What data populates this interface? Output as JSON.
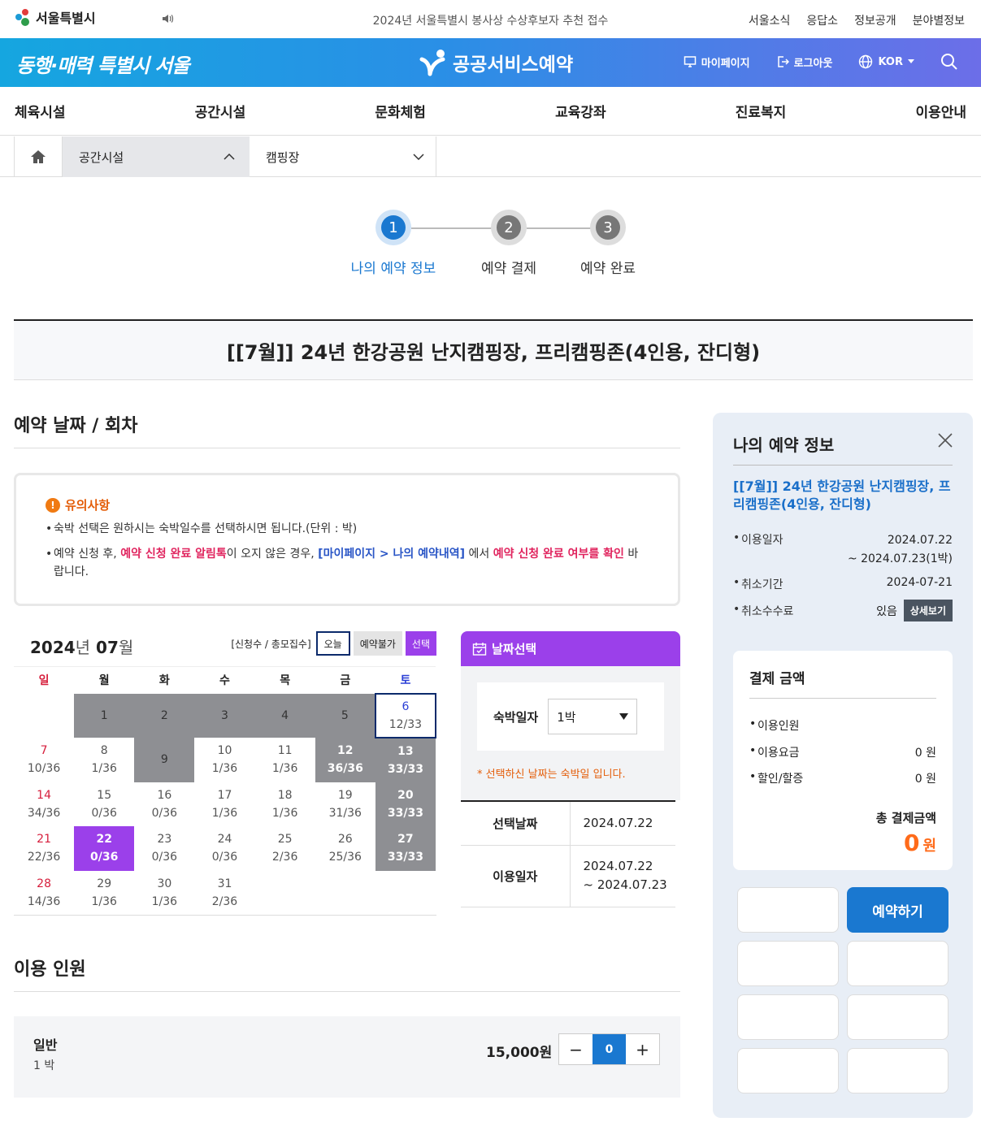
{
  "topbar": {
    "logo": "서울특별시",
    "notice": "2024년 서울특별시 봉사상 수상후보자 추천 접수",
    "links": [
      "서울소식",
      "응답소",
      "정보공개",
      "분야별정보"
    ]
  },
  "banner": {
    "slogan": "동행·매력 특별시 서울",
    "service": "공공서비스예약",
    "mypage": "마이페이지",
    "logout": "로그아웃",
    "lang": "KOR"
  },
  "gnb": [
    "체육시설",
    "공간시설",
    "문화체험",
    "교육강좌",
    "진료복지",
    "이용안내"
  ],
  "breadcrumb": {
    "level1": "공간시설",
    "level2": "캠핑장"
  },
  "steps": [
    "나의 예약 정보",
    "예약 결제",
    "예약 완료"
  ],
  "step_numbers": [
    "1",
    "2",
    "3"
  ],
  "title": "[[7월]] 24년 한강공원 난지캠핑장, 프리캠핑존(4인용, 잔디형)",
  "section_date": "예약 날짜 / 회차",
  "caution": {
    "head": "유의사항",
    "item1": "숙박 선택은 원하시는 숙박일수를 선택하시면 됩니다.(단위 : 박)",
    "item2_a": "예약 신청 후, ",
    "item2_b": "예약 신청 완료 알림톡",
    "item2_c": "이 오지 않은 경우, ",
    "item2_d": "[마이페이지 > 나의 예약내역]",
    "item2_e": " 에서 ",
    "item2_f": "예약 신청 완료 여부를 확인",
    "item2_g": " 바랍니다."
  },
  "calendar": {
    "year": "2024",
    "year_suffix": "년",
    "month": "07",
    "month_suffix": "월",
    "legend_label": "[신청수 / 총모집수]",
    "legend_today": "오늘",
    "legend_unavail": "예약불가",
    "legend_selected": "선택",
    "weekdays": [
      "일",
      "월",
      "화",
      "수",
      "목",
      "금",
      "토"
    ],
    "weeks": [
      [
        {
          "d": "",
          "s": ""
        },
        {
          "d": "1",
          "s": ""
        },
        {
          "d": "2",
          "s": ""
        },
        {
          "d": "3",
          "s": ""
        },
        {
          "d": "4",
          "s": ""
        },
        {
          "d": "5",
          "s": ""
        },
        {
          "d": "6",
          "s": "12/33"
        }
      ],
      [
        {
          "d": "7",
          "s": "10/36"
        },
        {
          "d": "8",
          "s": "1/36"
        },
        {
          "d": "9",
          "s": ""
        },
        {
          "d": "10",
          "s": "1/36"
        },
        {
          "d": "11",
          "s": "1/36"
        },
        {
          "d": "12",
          "s": "36/36"
        },
        {
          "d": "13",
          "s": "33/33"
        }
      ],
      [
        {
          "d": "14",
          "s": "34/36"
        },
        {
          "d": "15",
          "s": "0/36"
        },
        {
          "d": "16",
          "s": "0/36"
        },
        {
          "d": "17",
          "s": "1/36"
        },
        {
          "d": "18",
          "s": "1/36"
        },
        {
          "d": "19",
          "s": "31/36"
        },
        {
          "d": "20",
          "s": "33/33"
        }
      ],
      [
        {
          "d": "21",
          "s": "22/36"
        },
        {
          "d": "22",
          "s": "0/36"
        },
        {
          "d": "23",
          "s": "0/36"
        },
        {
          "d": "24",
          "s": "0/36"
        },
        {
          "d": "25",
          "s": "2/36"
        },
        {
          "d": "26",
          "s": "25/36"
        },
        {
          "d": "27",
          "s": "33/33"
        }
      ],
      [
        {
          "d": "28",
          "s": "14/36"
        },
        {
          "d": "29",
          "s": "1/36"
        },
        {
          "d": "30",
          "s": "1/36"
        },
        {
          "d": "31",
          "s": "2/36"
        },
        {
          "d": "",
          "s": ""
        },
        {
          "d": "",
          "s": ""
        },
        {
          "d": "",
          "s": ""
        }
      ]
    ]
  },
  "datebox": {
    "header": "날짜선택",
    "stay_label": "숙박일자",
    "stay_value": "1박",
    "warn": "* 선택하신 날짜는 숙박일 입니다.",
    "selected_label": "선택날짜",
    "selected_value": "2024.07.22",
    "use_label": "이용일자",
    "use_value1": "2024.07.22",
    "use_value2": "~ 2024.07.23"
  },
  "section_people": "이용 인원",
  "person": {
    "name": "일반",
    "sub": "1 박",
    "price": "15,000원",
    "count": "0",
    "minus": "−",
    "plus": "+"
  },
  "side": {
    "title": "나의 예약 정보",
    "product": "[[7월]] 24년 한강공원 난지캠핑장, 프리캠핑존(4인용, 잔디형)",
    "use_label": "이용일자",
    "use_value1": "2024.07.22",
    "use_value2": "~ 2024.07.23(1박)",
    "cancel_label": "취소기간",
    "cancel_value": "2024-07-21",
    "fee_label": "취소수수료",
    "fee_value": "있음",
    "detail": "상세보기",
    "pay_title": "결제 금액",
    "people_label": "이용인원",
    "fee2_label": "이용요금",
    "fee2_value": "0 원",
    "discount_label": "할인/할증",
    "discount_value": "0 원",
    "total_label": "총 결제금액",
    "total_value": "0",
    "total_unit": "원",
    "reserve": "예약하기"
  }
}
